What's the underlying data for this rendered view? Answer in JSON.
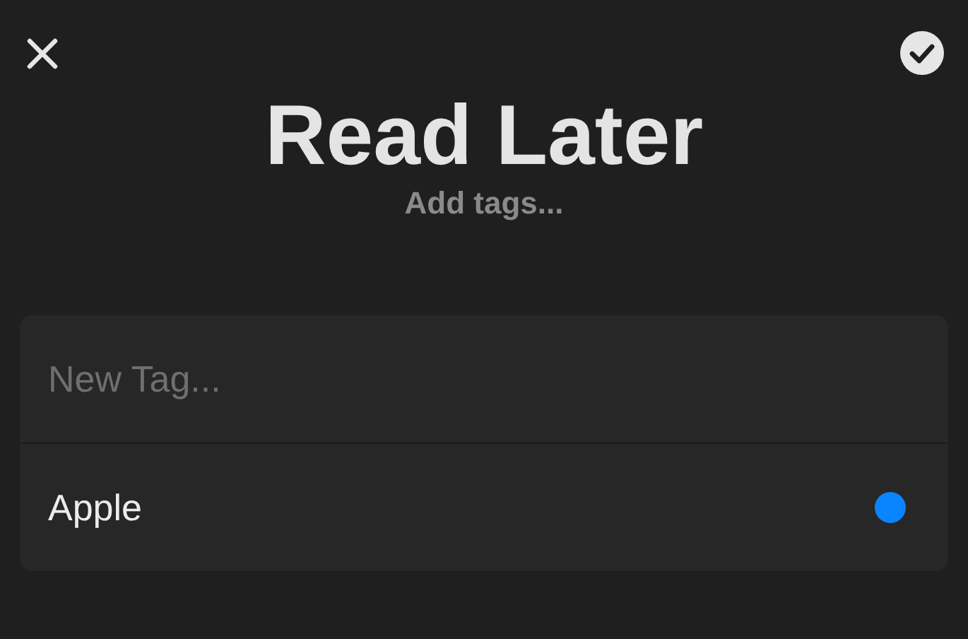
{
  "title": "Read Later",
  "subtitle": "Add tags...",
  "new_tag": {
    "placeholder": "New Tag..."
  },
  "tags": [
    {
      "label": "Apple",
      "color": "#0a84ff"
    }
  ]
}
